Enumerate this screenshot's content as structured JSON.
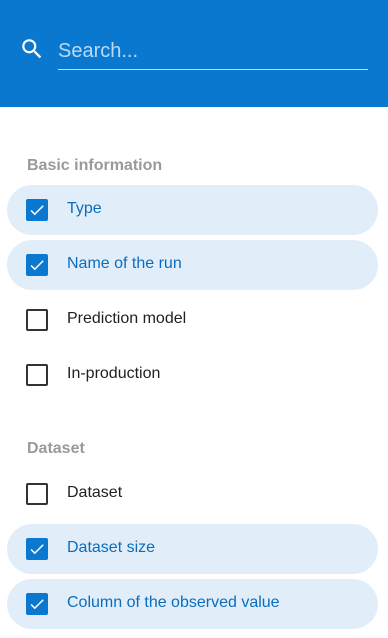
{
  "search": {
    "placeholder": "Search...",
    "value": "",
    "icon": "search-icon"
  },
  "colors": {
    "accent": "#0b78d0",
    "selected_row": "#e1eef9",
    "section_title": "#9a9a9a"
  },
  "sections": [
    {
      "title": "Basic information",
      "items": [
        {
          "label": "Type",
          "checked": true
        },
        {
          "label": "Name of the run",
          "checked": true
        },
        {
          "label": "Prediction model",
          "checked": false
        },
        {
          "label": "In-production",
          "checked": false
        }
      ]
    },
    {
      "title": "Dataset",
      "items": [
        {
          "label": "Dataset",
          "checked": false
        },
        {
          "label": "Dataset size",
          "checked": true
        },
        {
          "label": "Column of the observed value",
          "checked": true
        }
      ]
    }
  ]
}
